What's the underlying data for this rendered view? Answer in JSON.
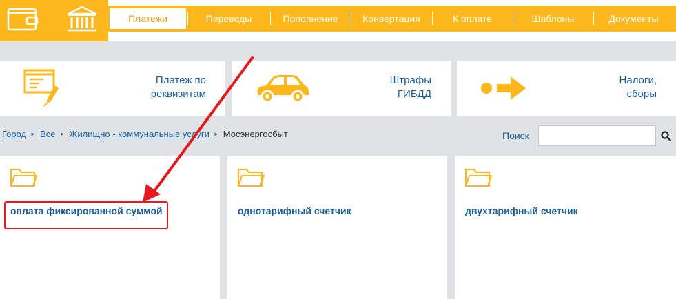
{
  "header": {
    "wallet_icon": "wallet-icon",
    "bank_icon": "bank-icon",
    "nav": [
      {
        "label": "Платежи",
        "active": true
      },
      {
        "label": "Переводы"
      },
      {
        "label": "Пополнение"
      },
      {
        "label": "Конвертация"
      },
      {
        "label": "К оплате"
      },
      {
        "label": "Шаблоны"
      },
      {
        "label": "Документы"
      }
    ]
  },
  "categories": [
    {
      "label": "Платеж по\nреквизитам",
      "icon": "form-pen-icon"
    },
    {
      "label": "Штрафы\nГИБДД",
      "icon": "car-icon"
    },
    {
      "label": "Налоги,\nсборы",
      "icon": "arrow-right-icon"
    }
  ],
  "breadcrumb": {
    "items": [
      "Город",
      "Все",
      "Жилищно - коммунальные услуги"
    ],
    "current": "Мосэнергосбыт"
  },
  "search": {
    "label": "Поиск",
    "placeholder": "",
    "value": ""
  },
  "services": [
    {
      "title": "оплата фиксированной суммой",
      "icon": "folder-icon"
    },
    {
      "title": "однотарифный счетчик",
      "icon": "folder-icon"
    },
    {
      "title": "двухтарифный счетчик",
      "icon": "folder-icon"
    }
  ],
  "colors": {
    "accent": "#fbb71b",
    "link": "#1c5f9f",
    "annotation": "#e8191e"
  }
}
